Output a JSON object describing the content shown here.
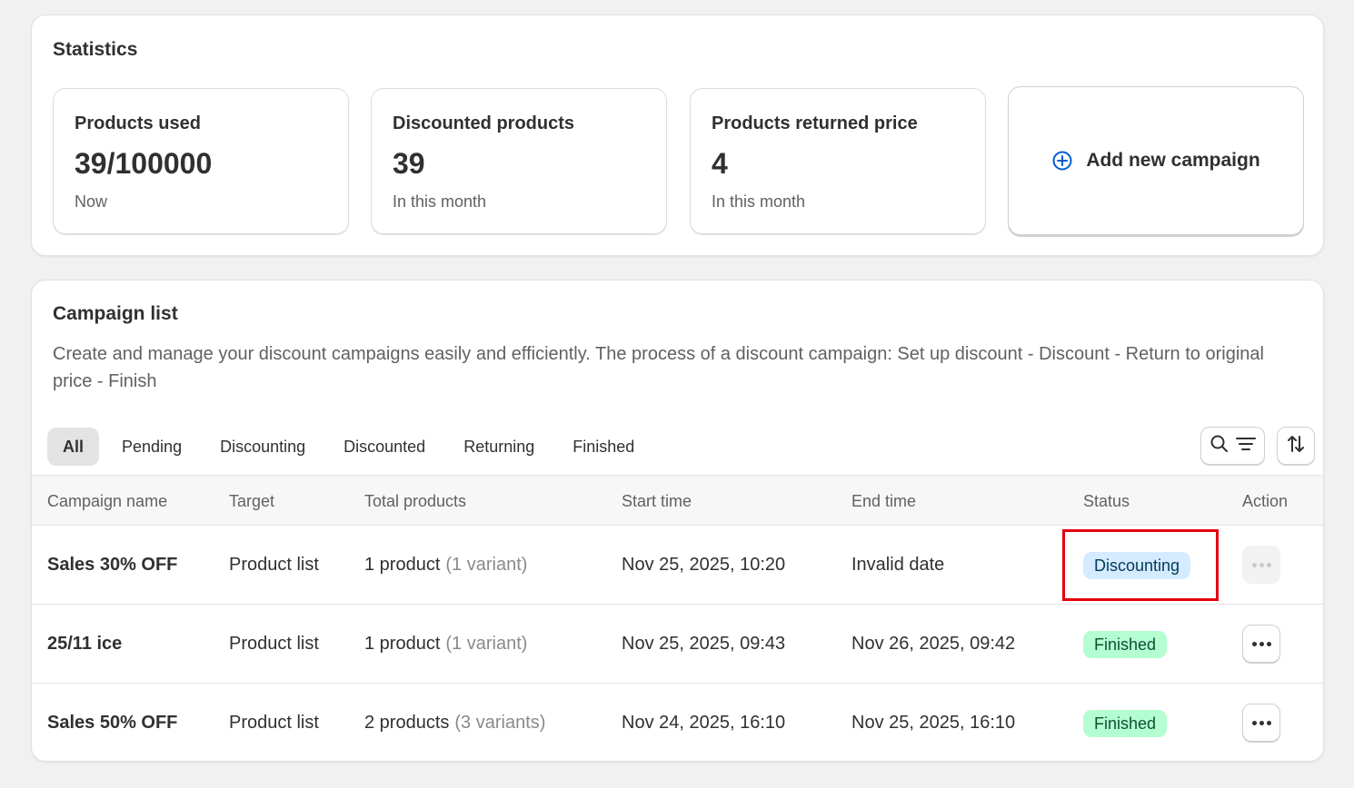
{
  "statistics": {
    "title": "Statistics",
    "cards": [
      {
        "label": "Products used",
        "value": "39/100000",
        "sub": "Now"
      },
      {
        "label": "Discounted products",
        "value": "39",
        "sub": "In this month"
      },
      {
        "label": "Products returned price",
        "value": "4",
        "sub": "In this month"
      }
    ],
    "add_campaign": {
      "label": "Add new campaign",
      "icon": "plus-circle-icon",
      "icon_color": "#005bd3"
    }
  },
  "campaign_list": {
    "title": "Campaign list",
    "description": "Create and manage your discount campaigns easily and efficiently. The process of a discount campaign: Set up discount - Discount - Return to original price - Finish",
    "tabs": [
      {
        "label": "All",
        "active": true
      },
      {
        "label": "Pending",
        "active": false
      },
      {
        "label": "Discounting",
        "active": false
      },
      {
        "label": "Discounted",
        "active": false
      },
      {
        "label": "Returning",
        "active": false
      },
      {
        "label": "Finished",
        "active": false
      }
    ],
    "tools": {
      "search_icon": "search-icon",
      "filter_icon": "filter-icon",
      "sort_icon": "sort-icon"
    },
    "columns": [
      "Campaign name",
      "Target",
      "Total products",
      "Start time",
      "End time",
      "Status",
      "Action"
    ],
    "rows": [
      {
        "name": "Sales 30% OFF",
        "target": "Product list",
        "products": "1 product",
        "variants": "(1 variant)",
        "start": "Nov 25, 2025, 10:20",
        "end": "Invalid date",
        "status": "Discounting",
        "action_enabled": false
      },
      {
        "name": "25/11 ice",
        "target": "Product list",
        "products": "1 product",
        "variants": "(1 variant)",
        "start": "Nov 25, 2025, 09:43",
        "end": "Nov 26, 2025, 09:42",
        "status": "Finished",
        "action_enabled": true
      },
      {
        "name": "Sales 50% OFF",
        "target": "Product list",
        "products": "2 products",
        "variants": "(3 variants)",
        "start": "Nov 24, 2025, 16:10",
        "end": "Nov 25, 2025, 16:10",
        "status": "Finished",
        "action_enabled": true
      }
    ]
  },
  "colors": {
    "discounting_badge_bg": "#d5ebff",
    "finished_badge_bg": "#b4fed2",
    "highlight": "#e3000f"
  }
}
